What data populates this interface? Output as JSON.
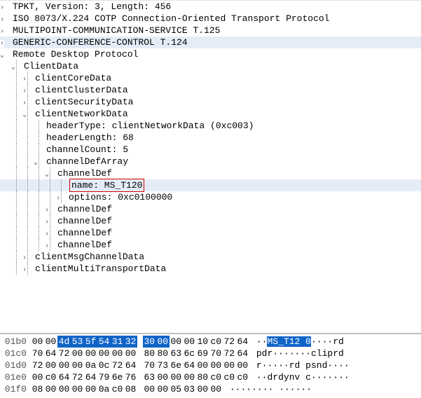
{
  "tree": {
    "r0": "TPKT, Version: 3, Length: 456",
    "r1": "ISO 8073/X.224 COTP Connection-Oriented Transport Protocol",
    "r2": "MULTIPOINT-COMMUNICATION-SERVICE T.125",
    "r3": "GENERIC-CONFERENCE-CONTROL T.124",
    "r4": "Remote Desktop Protocol",
    "r5": "ClientData",
    "r6": "clientCoreData",
    "r7": "clientClusterData",
    "r8": "clientSecurityData",
    "r9": "clientNetworkData",
    "r10": "headerType: clientNetworkData (0xc003)",
    "r11": "headerLength: 68",
    "r12": "channelCount: 5",
    "r13": "channelDefArray",
    "r14": "channelDef",
    "r15": "name: MS_T120",
    "r16": "options: 0xc0100000",
    "r17": "channelDef",
    "r18": "channelDef",
    "r19": "channelDef",
    "r20": "channelDef",
    "r21": "clientMsgChannelData",
    "r22": "clientMultiTransportData"
  },
  "hex": {
    "rows": [
      {
        "off": "01b0",
        "b": [
          "00",
          "00",
          "4d",
          "53",
          "5f",
          "54",
          "31",
          "32",
          "30",
          "00",
          "00",
          "00",
          "10",
          "c0",
          "72",
          "64"
        ],
        "sel": [
          2,
          3,
          4,
          5,
          6,
          7,
          8,
          9
        ],
        "asc": [
          "·",
          "·",
          "M",
          "S",
          "_",
          "T",
          "1",
          "2",
          " ",
          "0",
          "·",
          "·",
          "·",
          "·",
          "r",
          "d"
        ],
        "asel": [
          2,
          3,
          4,
          5,
          6,
          7,
          8,
          9
        ]
      },
      {
        "off": "01c0",
        "b": [
          "70",
          "64",
          "72",
          "00",
          "00",
          "00",
          "00",
          "00",
          "80",
          "80",
          "63",
          "6c",
          "69",
          "70",
          "72",
          "64"
        ],
        "sel": [],
        "asc": [
          "p",
          "d",
          "r",
          "·",
          "·",
          "·",
          "·",
          "·",
          "·",
          "·",
          "c",
          "l",
          "i",
          "p",
          "r",
          "d"
        ],
        "asel": []
      },
      {
        "off": "01d0",
        "b": [
          "72",
          "00",
          "00",
          "00",
          "0a",
          "0c",
          "72",
          "64",
          "70",
          "73",
          "6e",
          "64",
          "00",
          "00",
          "00",
          "00"
        ],
        "sel": [],
        "asc": [
          "r",
          "·",
          "·",
          "·",
          "·",
          "·",
          "r",
          "d",
          " ",
          "p",
          "s",
          "n",
          "d",
          "·",
          "·",
          "·",
          "·"
        ],
        "asel": []
      },
      {
        "off": "01e0",
        "b": [
          "00",
          "c0",
          "64",
          "72",
          "64",
          "79",
          "6e",
          "76",
          "63",
          "00",
          "00",
          "00",
          "80",
          "c0",
          "c0",
          "c0"
        ],
        "sel": [],
        "asc": [
          "·",
          "·",
          "d",
          "r",
          "d",
          "y",
          "n",
          "v",
          " ",
          "c",
          "·",
          "·",
          "·",
          "·",
          "·",
          "·",
          "·"
        ],
        "asel": []
      },
      {
        "off": "01f0",
        "b": [
          "08",
          "00",
          "00",
          "00",
          "00",
          "0a",
          "c0",
          "08",
          "00",
          "00",
          "05",
          "03",
          "00",
          "00"
        ],
        "sel": [],
        "asc": [
          "·",
          "·",
          "·",
          "·",
          "·",
          "·",
          "·",
          "·",
          " ",
          "·",
          "·",
          "·",
          "·",
          "·",
          "·"
        ],
        "asel": []
      }
    ]
  }
}
